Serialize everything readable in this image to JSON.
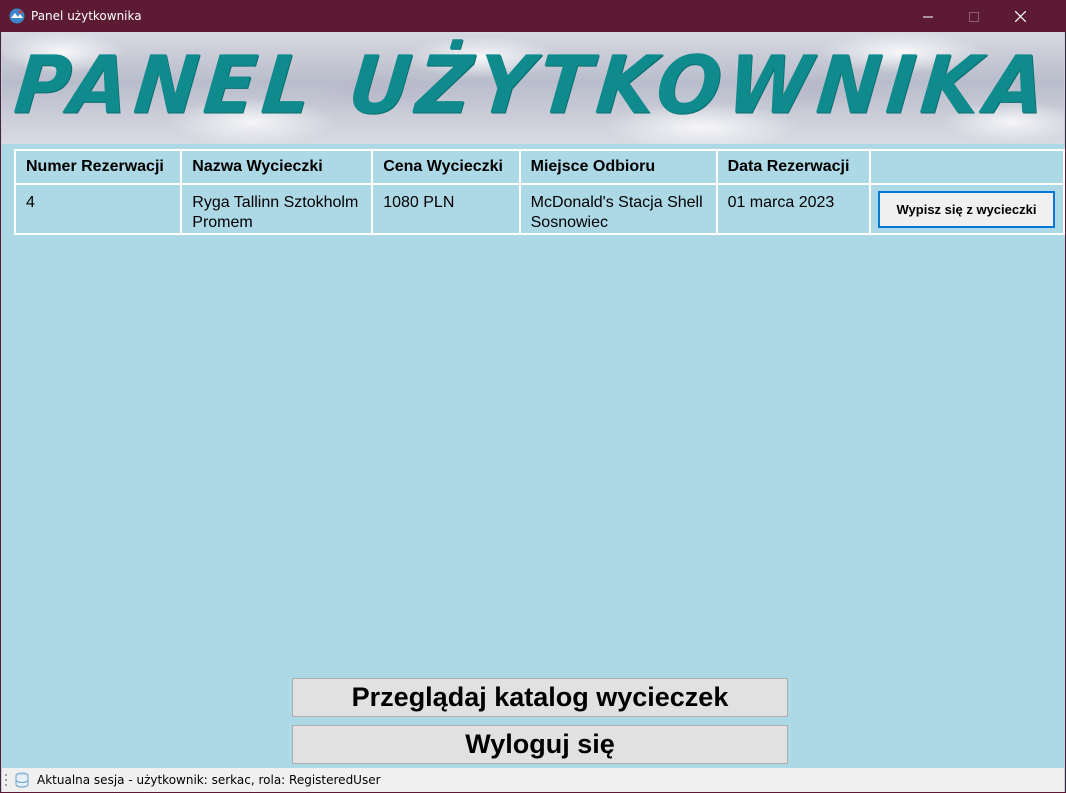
{
  "window": {
    "title": "Panel użytkownika",
    "titlebar_color": "#5c1a33",
    "controls": [
      "minimize-icon",
      "maximize-icon",
      "close-icon"
    ]
  },
  "banner": {
    "title": "PANEL UŻYTKOWNIKA",
    "title_color": "#0f8b8d"
  },
  "table": {
    "headers": [
      "Numer Rezerwacji",
      "Nazwa Wycieczki",
      "Cena Wycieczki",
      "Miejsce Odbioru",
      "Data Rezerwacji",
      ""
    ],
    "rows": [
      {
        "numer": "4",
        "nazwa": "Ryga Tallinn Sztokholm Promem",
        "cena": "1080 PLN",
        "miejsce": "McDonald's Stacja Shell Sosnowiec",
        "data": "01 marca 2023",
        "action_label": "Wypisz się z wycieczki"
      }
    ]
  },
  "buttons": {
    "catalog_label": "Przeglądaj katalog wycieczek",
    "logout_label": "Wyloguj się"
  },
  "statusbar": {
    "text": "Aktualna sesja - użytkownik: serkac, rola: RegisteredUser",
    "icon": "database-icon"
  },
  "colors": {
    "background": "#add8e6",
    "button_focus_border": "#0078d7"
  }
}
